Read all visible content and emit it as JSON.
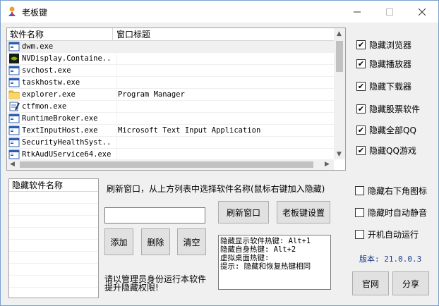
{
  "window": {
    "title": "老板键"
  },
  "process_list": {
    "columns": [
      "软件名称",
      "窗口标题"
    ],
    "rows": [
      {
        "name": "dwm.exe",
        "title": "",
        "icon": "app-window-icon"
      },
      {
        "name": "NVDisplay.Containe...",
        "title": "",
        "icon": "nvidia-icon"
      },
      {
        "name": "svchost.exe",
        "title": "",
        "icon": "app-window-icon"
      },
      {
        "name": "taskhostw.exe",
        "title": "",
        "icon": "app-window-icon"
      },
      {
        "name": "explorer.exe",
        "title": "Program Manager",
        "icon": "folder-icon"
      },
      {
        "name": "ctfmon.exe",
        "title": "",
        "icon": "notepad-icon"
      },
      {
        "name": "RuntimeBroker.exe",
        "title": "",
        "icon": "app-window-icon"
      },
      {
        "name": "TextInputHost.exe",
        "title": "Microsoft Text Input Application",
        "icon": "app-window-icon"
      },
      {
        "name": "SecurityHealthSyst...",
        "title": "",
        "icon": "app-window-icon"
      },
      {
        "name": "RtkAudUService64.exe",
        "title": "",
        "icon": "app-window-icon"
      }
    ]
  },
  "options": [
    {
      "label": "隐藏浏览器",
      "checked": true
    },
    {
      "label": "隐藏播放器",
      "checked": true
    },
    {
      "label": "隐藏下载器",
      "checked": true
    },
    {
      "label": "隐藏股票软件",
      "checked": true
    },
    {
      "label": "隐藏全部QQ",
      "checked": true
    },
    {
      "label": "隐藏QQ游戏",
      "checked": true
    },
    {
      "label": "隐藏右下角图标",
      "checked": false
    },
    {
      "label": "隐藏时自动静音",
      "checked": false
    },
    {
      "label": "开机自动运行",
      "checked": false
    }
  ],
  "hidden_list": {
    "header": "隐藏软件名称"
  },
  "instruction": "刷新窗口，从上方列表中选择软件名称(鼠标右键加入隐藏)",
  "software_input": {
    "value": ""
  },
  "buttons": {
    "refresh": "刷新窗口",
    "settings": "老板键设置",
    "add": "添加",
    "delete": "删除",
    "clear": "清空",
    "website": "官网",
    "share": "分享"
  },
  "hotkeys": {
    "line1": "隐藏显示软件热键: Alt+1",
    "line2": "隐藏自身热键: Alt+2",
    "line3": "虚拟桌面热键:",
    "line4": "提示: 隐藏和恢复热键相同"
  },
  "admin_note": {
    "line1": "请以管理员身份运行本软件",
    "line2": "提升隐藏权限!"
  },
  "version": "版本: 21.0.0.3"
}
